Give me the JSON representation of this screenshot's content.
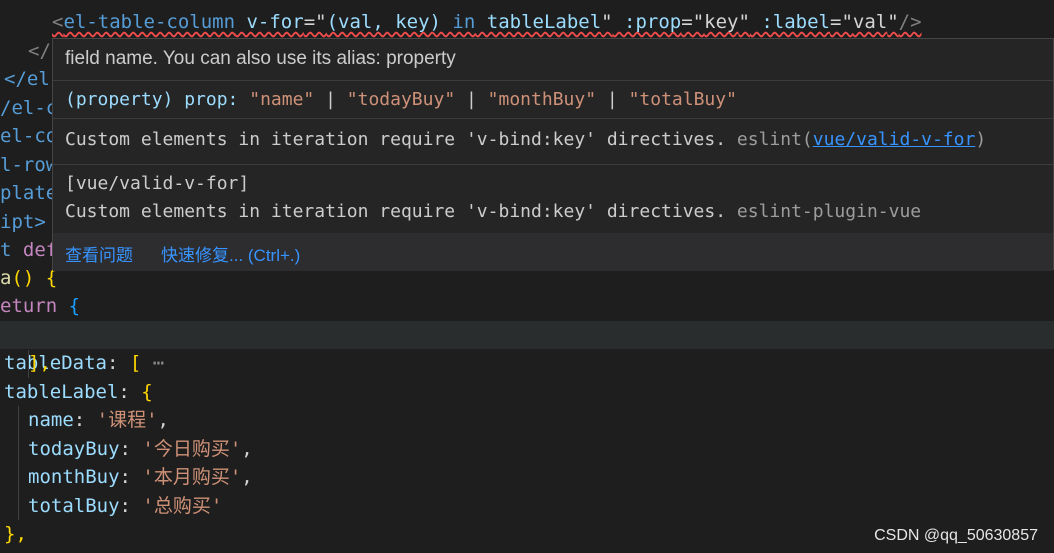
{
  "code": {
    "top_comment_fragment": "　　　　　　　　　　　　　　　",
    "l1": {
      "open": "<",
      "tag": "el-table-column",
      "vfor_attr": " v-for",
      "eq1": "=\"",
      "vfor_val": "(val, key) ",
      "in_kw": "in",
      "vfor_rest": " tableLabel",
      "q1": "\"",
      "prop_attr": " :prop",
      "eq2": "=\"",
      "prop_val": "key",
      "q2": "\"",
      "label_attr": " :label",
      "eq3": "=\"",
      "label_val": "val",
      "q3": "\"",
      "close": "/>"
    },
    "l2": "</",
    "l3": "</el",
    "l4": "/el-c",
    "l5": "el-co",
    "l6": "l-row",
    "l7": "plate",
    "l8": "ipt>",
    "l9_kw": "t",
    "l9_rest": " def",
    "l10_fn": "a",
    "l10_rest": "() {",
    "l11_kw": "eturn",
    "l11_brace": " {",
    "l12_prop": "tableData",
    "l12_colon": ": ",
    "l12_bracket": "[",
    "l12_fold": " ⋯",
    "l13": "],",
    "l14_prop": "tableLabel",
    "l14_colon": ": ",
    "l14_brace": "{",
    "l15_prop": "name",
    "l15_val": "'课程'",
    "l16_prop": "todayBuy",
    "l16_val": "'今日购买'",
    "l17_prop": "monthBuy",
    "l17_val": "'本月购买'",
    "l18_prop": "totalBuy",
    "l18_val": "'总购买'",
    "l19": "},"
  },
  "hover": {
    "doc": "field name. You can also use its alias: property",
    "signature": {
      "prefix": "(property) prop: ",
      "v1": "\"name\"",
      "sep": " | ",
      "v2": "\"todayBuy\"",
      "v3": "\"monthBuy\"",
      "v4": "\"totalBuy\""
    },
    "diag1": {
      "message": "Custom elements in iteration require 'v-bind:key' directives.",
      "source_prefix": " eslint(",
      "rule_link": "vue/valid-v-for",
      "source_suffix": ")"
    },
    "diag2": {
      "rule": "[vue/valid-v-for]",
      "message": "Custom elements in iteration require 'v-bind:key' directives.",
      "source": " eslint-plugin-vue"
    },
    "actions": {
      "view_problem": "查看问题",
      "quick_fix": "快速修复... (Ctrl+.)"
    }
  },
  "watermark": "CSDN @qq_50630857",
  "colors": {
    "background": "#1e1e1e",
    "hover_background": "#252526",
    "link": "#3794ff",
    "error_squiggle": "#f14c4c"
  }
}
